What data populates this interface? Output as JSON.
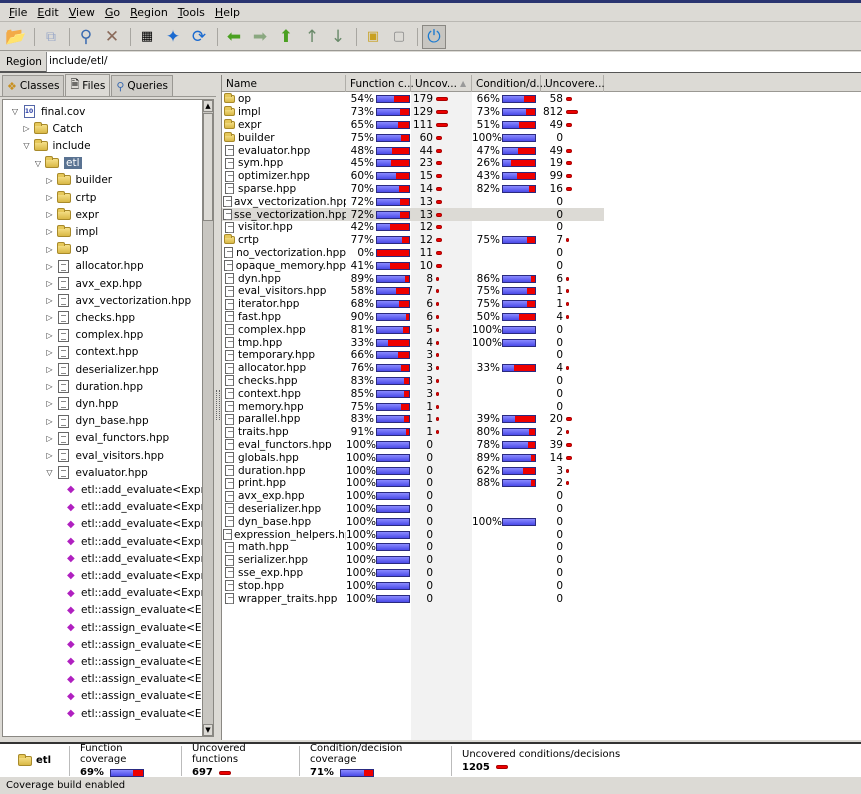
{
  "menu": [
    "File",
    "Edit",
    "View",
    "Go",
    "Region",
    "Tools",
    "Help"
  ],
  "toolbar": {
    "icons": [
      "open-icon",
      "copy-icon",
      "find-icon",
      "delete-icon",
      "columns-icon",
      "pin-icon",
      "refresh-icon",
      "back-icon",
      "forward-icon",
      "up-icon",
      "previous-uncovered-icon",
      "next-uncovered-icon",
      "region-include-icon",
      "region-exclude-icon",
      "coverage-power-icon"
    ]
  },
  "region": {
    "label": "Region",
    "value": "include/etl/"
  },
  "tabs": [
    {
      "label": "Classes",
      "icon": "classes-icon"
    },
    {
      "label": "Files",
      "icon": "files-icon",
      "selected": true
    },
    {
      "label": "Queries",
      "icon": "queries-icon"
    }
  ],
  "tree": [
    {
      "label": "final.cov",
      "type": "cov",
      "level": 0,
      "expanded": true
    },
    {
      "label": "Catch",
      "type": "folder",
      "level": 1,
      "expanded": false
    },
    {
      "label": "include",
      "type": "folder",
      "level": 1,
      "expanded": true
    },
    {
      "label": "etl",
      "type": "folder",
      "level": 2,
      "expanded": true,
      "selected": true
    },
    {
      "label": "builder",
      "type": "folder",
      "level": 3,
      "expanded": false
    },
    {
      "label": "crtp",
      "type": "folder",
      "level": 3,
      "expanded": false
    },
    {
      "label": "expr",
      "type": "folder",
      "level": 3,
      "expanded": false
    },
    {
      "label": "impl",
      "type": "folder",
      "level": 3,
      "expanded": false
    },
    {
      "label": "op",
      "type": "folder",
      "level": 3,
      "expanded": false
    },
    {
      "label": "allocator.hpp",
      "type": "file",
      "level": 3,
      "expanded": false
    },
    {
      "label": "avx_exp.hpp",
      "type": "file",
      "level": 3,
      "expanded": false
    },
    {
      "label": "avx_vectorization.hpp",
      "type": "file",
      "level": 3,
      "expanded": false
    },
    {
      "label": "checks.hpp",
      "type": "file",
      "level": 3,
      "expanded": false
    },
    {
      "label": "complex.hpp",
      "type": "file",
      "level": 3,
      "expanded": false
    },
    {
      "label": "context.hpp",
      "type": "file",
      "level": 3,
      "expanded": false
    },
    {
      "label": "deserializer.hpp",
      "type": "file",
      "level": 3,
      "expanded": false
    },
    {
      "label": "duration.hpp",
      "type": "file",
      "level": 3,
      "expanded": false
    },
    {
      "label": "dyn.hpp",
      "type": "file",
      "level": 3,
      "expanded": false
    },
    {
      "label": "dyn_base.hpp",
      "type": "file",
      "level": 3,
      "expanded": false
    },
    {
      "label": "eval_functors.hpp",
      "type": "file",
      "level": 3,
      "expanded": false
    },
    {
      "label": "eval_visitors.hpp",
      "type": "file",
      "level": 3,
      "expanded": false
    },
    {
      "label": "evaluator.hpp",
      "type": "file",
      "level": 3,
      "expanded": true
    },
    {
      "label": "etl::add_evaluate<Expr,F",
      "type": "fn",
      "level": 4
    },
    {
      "label": "etl::add_evaluate<Expr,F",
      "type": "fn",
      "level": 4
    },
    {
      "label": "etl::add_evaluate<Expr,F",
      "type": "fn",
      "level": 4
    },
    {
      "label": "etl::add_evaluate<Expr,F",
      "type": "fn",
      "level": 4
    },
    {
      "label": "etl::add_evaluate<Expr,F",
      "type": "fn",
      "level": 4
    },
    {
      "label": "etl::add_evaluate<Expr,F",
      "type": "fn",
      "level": 4
    },
    {
      "label": "etl::add_evaluate<Expr,F",
      "type": "fn",
      "level": 4
    },
    {
      "label": "etl::assign_evaluate<Exp",
      "type": "fn",
      "level": 4
    },
    {
      "label": "etl::assign_evaluate<Exp",
      "type": "fn",
      "level": 4
    },
    {
      "label": "etl::assign_evaluate<Exp",
      "type": "fn",
      "level": 4
    },
    {
      "label": "etl::assign_evaluate<Exp",
      "type": "fn",
      "level": 4
    },
    {
      "label": "etl::assign_evaluate<Exp",
      "type": "fn",
      "level": 4
    },
    {
      "label": "etl::assign_evaluate<Exp",
      "type": "fn",
      "level": 4
    },
    {
      "label": "etl::assign_evaluate<Exp",
      "type": "fn",
      "level": 4
    }
  ],
  "table": {
    "columns": [
      "Name",
      "Function c...",
      "Uncov...",
      "Condition/d...",
      "Uncovere..."
    ],
    "sort_column": 2,
    "rows": [
      {
        "name": "op",
        "type": "folder",
        "fc": 54,
        "uf": 179,
        "cd": 66,
        "uc": 58
      },
      {
        "name": "impl",
        "type": "folder",
        "fc": 73,
        "uf": 129,
        "cd": 73,
        "uc": 812
      },
      {
        "name": "expr",
        "type": "folder",
        "fc": 65,
        "uf": 111,
        "cd": 51,
        "uc": 49
      },
      {
        "name": "builder",
        "type": "folder",
        "fc": 75,
        "uf": 60,
        "cd": 100,
        "uc": 0
      },
      {
        "name": "evaluator.hpp",
        "type": "file",
        "fc": 48,
        "uf": 44,
        "cd": 47,
        "uc": 49
      },
      {
        "name": "sym.hpp",
        "type": "file",
        "fc": 45,
        "uf": 23,
        "cd": 26,
        "uc": 19
      },
      {
        "name": "optimizer.hpp",
        "type": "file",
        "fc": 60,
        "uf": 15,
        "cd": 43,
        "uc": 99
      },
      {
        "name": "sparse.hpp",
        "type": "file",
        "fc": 70,
        "uf": 14,
        "cd": 82,
        "uc": 16
      },
      {
        "name": "avx_vectorization.hpp",
        "type": "file",
        "fc": 72,
        "uf": 13,
        "cd": null,
        "uc": 0
      },
      {
        "name": "sse_vectorization.hpp",
        "type": "file",
        "fc": 72,
        "uf": 13,
        "cd": null,
        "uc": 0,
        "highlighted": true
      },
      {
        "name": "visitor.hpp",
        "type": "file",
        "fc": 42,
        "uf": 12,
        "cd": null,
        "uc": 0
      },
      {
        "name": "crtp",
        "type": "folder",
        "fc": 77,
        "uf": 12,
        "cd": 75,
        "uc": 7
      },
      {
        "name": "no_vectorization.hpp",
        "type": "file",
        "fc": 0,
        "uf": 11,
        "cd": null,
        "uc": 0
      },
      {
        "name": "opaque_memory.hpp",
        "type": "file",
        "fc": 41,
        "uf": 10,
        "cd": null,
        "uc": 0
      },
      {
        "name": "dyn.hpp",
        "type": "file",
        "fc": 89,
        "uf": 8,
        "cd": 86,
        "uc": 6
      },
      {
        "name": "eval_visitors.hpp",
        "type": "file",
        "fc": 58,
        "uf": 7,
        "cd": 75,
        "uc": 1
      },
      {
        "name": "iterator.hpp",
        "type": "file",
        "fc": 68,
        "uf": 6,
        "cd": 75,
        "uc": 1
      },
      {
        "name": "fast.hpp",
        "type": "file",
        "fc": 90,
        "uf": 6,
        "cd": 50,
        "uc": 4
      },
      {
        "name": "complex.hpp",
        "type": "file",
        "fc": 81,
        "uf": 5,
        "cd": 100,
        "uc": 0
      },
      {
        "name": "tmp.hpp",
        "type": "file",
        "fc": 33,
        "uf": 4,
        "cd": 100,
        "uc": 0
      },
      {
        "name": "temporary.hpp",
        "type": "file",
        "fc": 66,
        "uf": 3,
        "cd": null,
        "uc": 0
      },
      {
        "name": "allocator.hpp",
        "type": "file",
        "fc": 76,
        "uf": 3,
        "cd": 33,
        "uc": 4
      },
      {
        "name": "checks.hpp",
        "type": "file",
        "fc": 83,
        "uf": 3,
        "cd": null,
        "uc": 0
      },
      {
        "name": "context.hpp",
        "type": "file",
        "fc": 85,
        "uf": 3,
        "cd": null,
        "uc": 0
      },
      {
        "name": "memory.hpp",
        "type": "file",
        "fc": 75,
        "uf": 1,
        "cd": null,
        "uc": 0
      },
      {
        "name": "parallel.hpp",
        "type": "file",
        "fc": 83,
        "uf": 1,
        "cd": 39,
        "uc": 20
      },
      {
        "name": "traits.hpp",
        "type": "file",
        "fc": 91,
        "uf": 1,
        "cd": 80,
        "uc": 2
      },
      {
        "name": "eval_functors.hpp",
        "type": "file",
        "fc": 100,
        "uf": 0,
        "cd": 78,
        "uc": 39
      },
      {
        "name": "globals.hpp",
        "type": "file",
        "fc": 100,
        "uf": 0,
        "cd": 89,
        "uc": 14
      },
      {
        "name": "duration.hpp",
        "type": "file",
        "fc": 100,
        "uf": 0,
        "cd": 62,
        "uc": 3
      },
      {
        "name": "print.hpp",
        "type": "file",
        "fc": 100,
        "uf": 0,
        "cd": 88,
        "uc": 2
      },
      {
        "name": "avx_exp.hpp",
        "type": "file",
        "fc": 100,
        "uf": 0,
        "cd": null,
        "uc": 0
      },
      {
        "name": "deserializer.hpp",
        "type": "file",
        "fc": 100,
        "uf": 0,
        "cd": null,
        "uc": 0
      },
      {
        "name": "dyn_base.hpp",
        "type": "file",
        "fc": 100,
        "uf": 0,
        "cd": 100,
        "uc": 0
      },
      {
        "name": "expression_helpers.hpp",
        "type": "file",
        "fc": 100,
        "uf": 0,
        "cd": null,
        "uc": 0
      },
      {
        "name": "math.hpp",
        "type": "file",
        "fc": 100,
        "uf": 0,
        "cd": null,
        "uc": 0
      },
      {
        "name": "serializer.hpp",
        "type": "file",
        "fc": 100,
        "uf": 0,
        "cd": null,
        "uc": 0
      },
      {
        "name": "sse_exp.hpp",
        "type": "file",
        "fc": 100,
        "uf": 0,
        "cd": null,
        "uc": 0
      },
      {
        "name": "stop.hpp",
        "type": "file",
        "fc": 100,
        "uf": 0,
        "cd": null,
        "uc": 0
      },
      {
        "name": "wrapper_traits.hpp",
        "type": "file",
        "fc": 100,
        "uf": 0,
        "cd": null,
        "uc": 0
      }
    ]
  },
  "summary": {
    "name": "etl",
    "function_coverage_label": "Function coverage",
    "function_coverage": "69%",
    "function_coverage_value": 69,
    "uncovered_functions_label": "Uncovered functions",
    "uncovered_functions": "697",
    "condition_coverage_label": "Condition/decision coverage",
    "condition_coverage": "71%",
    "condition_coverage_value": 71,
    "uncovered_conditions_label": "Uncovered conditions/decisions",
    "uncovered_conditions": "1205"
  },
  "status": "Coverage build enabled",
  "colors": {
    "covered": "#5a5af0",
    "uncovered": "#e00000",
    "selection": "#5a7392"
  }
}
